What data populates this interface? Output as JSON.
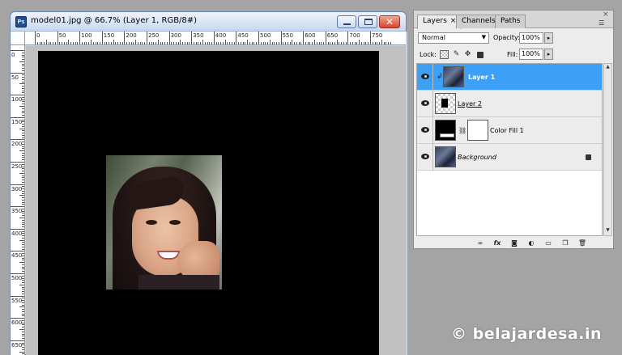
{
  "document": {
    "title": "model01.jpg @ 66.7% (Layer 1, RGB/8#)",
    "app_icon": "Ps",
    "ruler_h_labels": [
      "0",
      "50",
      "100",
      "150",
      "200",
      "250",
      "300",
      "350",
      "400",
      "450",
      "500",
      "550",
      "600",
      "650",
      "700",
      "750"
    ],
    "ruler_v_labels": [
      "0",
      "50",
      "100",
      "150",
      "200",
      "250",
      "300",
      "350",
      "400",
      "450",
      "500",
      "550",
      "600",
      "650"
    ]
  },
  "layers_panel": {
    "tabs": [
      {
        "label": "Layers",
        "close": "×"
      },
      {
        "label": "Channels"
      },
      {
        "label": "Paths"
      }
    ],
    "panel_close": "×",
    "panel_menu": "☰",
    "blend_mode": "Normal",
    "opacity_label": "Opacity:",
    "opacity_value": "100%",
    "lock_label": "Lock:",
    "fill_label": "Fill:",
    "fill_value": "100%",
    "layers": [
      {
        "name": "Layer 1",
        "selected": true
      },
      {
        "name": "Layer 2",
        "selected": false
      },
      {
        "name": "Color Fill 1",
        "selected": false
      },
      {
        "name": "Background",
        "selected": false
      }
    ]
  },
  "watermark": "© belajardesa.in",
  "icons": {
    "eye": "eye-icon",
    "link": "link-icon",
    "lock": "lock-icon"
  }
}
